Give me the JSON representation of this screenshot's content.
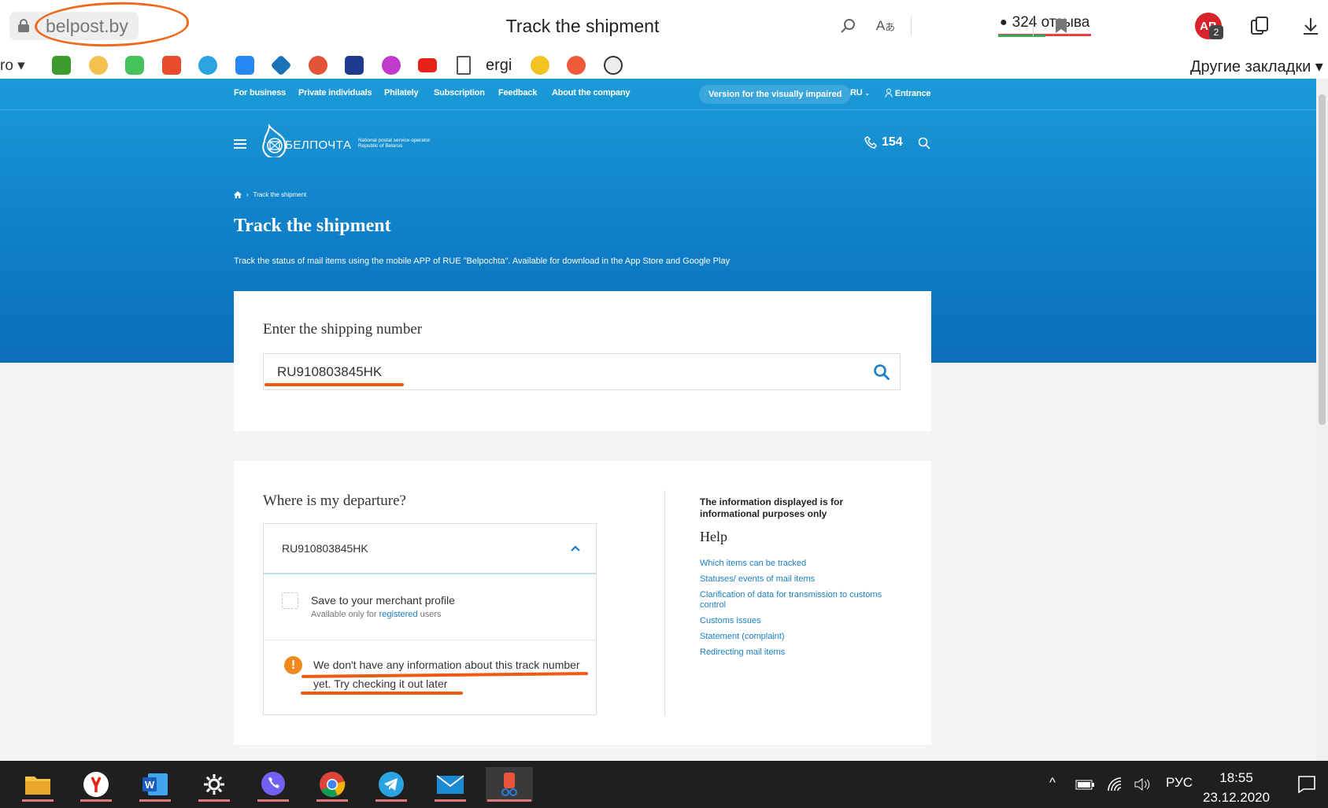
{
  "browser": {
    "url": "belpost.by",
    "title": "Track the shipment",
    "reviews": "324 отзыва",
    "adblock_badge": "2",
    "bookmark_left": "ro",
    "bookmark_text": "ergi",
    "other_bookmarks": "Другие закладки"
  },
  "site": {
    "nav": [
      "For business",
      "Private individuals",
      "Philately",
      "Subscription",
      "Feedback",
      "About the company"
    ],
    "visually_impaired": "Version for the visually impaired",
    "lang": "RU",
    "entrance": "Entrance",
    "logo_text": "БЕЛПОЧТА",
    "logo_sub_1": "National postal service operator",
    "logo_sub_2": "Republic of Belarus",
    "phone": "154",
    "breadcrumb": "Track the shipment",
    "title": "Track the shipment",
    "lead": "Track the status of mail items using the mobile APP of RUE \"Belpochta\". Available for download in the App Store and Google Play"
  },
  "search_form": {
    "label": "Enter the shipping number",
    "value": "RU910803845HK"
  },
  "result": {
    "label": "Where is my departure?",
    "track_number": "RU910803845HK",
    "save_title": "Save to your merchant profile",
    "save_sub_prefix": "Available only for",
    "save_sub_link": "registered",
    "save_sub_suffix": "users",
    "warning": "We don't have any information about this track number yet. Try checking it out later"
  },
  "help": {
    "note": "The information displayed is for informational purposes only",
    "title": "Help",
    "links": [
      "Which items can be tracked",
      "Statuses/ events of mail items",
      "Clarification of data for transmission to customs control",
      "Customs issues",
      "Statement (complaint)",
      "Redirecting mail items"
    ]
  },
  "taskbar": {
    "lang": "РУС",
    "time": "18:55",
    "date": "23.12.2020"
  },
  "colors": {
    "brand_blue": "#0f7fc9",
    "annotation_orange": "#ee5a12",
    "warning_orange": "#f08a1c",
    "link_blue": "#1a7fc7"
  }
}
